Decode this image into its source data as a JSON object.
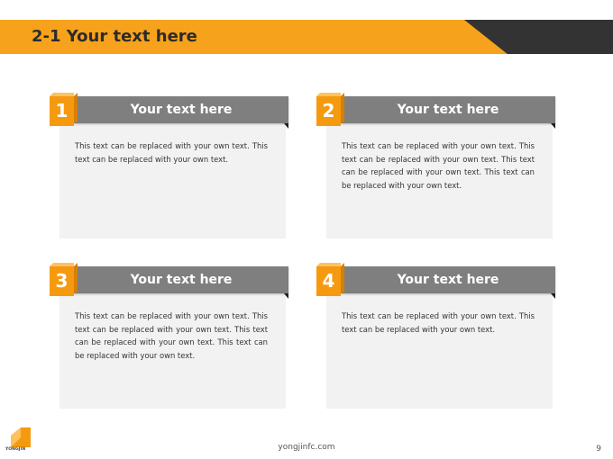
{
  "slide": {
    "title": "2-1 Your text here",
    "colors": {
      "accent": "#f7a21c",
      "dark": "#333333",
      "header_gray": "#7f7f7f",
      "card_bg": "#f2f2f2"
    }
  },
  "cards": [
    {
      "number": "1",
      "title": "Your text here",
      "text": "This text can be replaced with your own text. This text can be replaced with your own text."
    },
    {
      "number": "2",
      "title": "Your text here",
      "text": "This text can be replaced with your own text. This text can be replaced with your own text. This text can be replaced with your own text. This text can be replaced with your own text."
    },
    {
      "number": "3",
      "title": "Your text here",
      "text": "This text can be replaced with your own text. This text can be replaced with your own text. This text can be replaced with your own text. This text can be replaced with your own text."
    },
    {
      "number": "4",
      "title": "Your text here",
      "text": "This text can be replaced with your own text. This text can be replaced with your own text."
    }
  ],
  "footer": {
    "logo_text": "YONGJIN",
    "website": "yongjinfc.com",
    "page_number": "9"
  }
}
